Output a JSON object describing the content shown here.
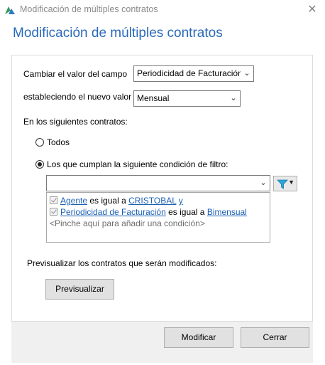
{
  "window": {
    "title": "Modificación de múltiples contratos",
    "close_glyph": "✕",
    "icon": "app-logo-icon"
  },
  "heading": "Modificación de múltiples contratos",
  "field_change": {
    "label": "Cambiar el valor del campo",
    "selected": "Periodicidad de Facturación"
  },
  "new_value": {
    "label": "estableciendo el nuevo valor",
    "selected": "Mensual"
  },
  "contracts_label": "En los siguientes contratos:",
  "options": {
    "all": {
      "label": "Todos",
      "selected": false
    },
    "filter": {
      "label": "Los que cumplan la siguiente condición de filtro:",
      "selected": true
    }
  },
  "filter_combo": {
    "value": ""
  },
  "filter_button_icon": "funnel-icon",
  "conditions": [
    {
      "field": "Agente",
      "op": " es igual a ",
      "value": "CRISTOBAL",
      "join": "y"
    },
    {
      "field": "Periodicidad de Facturación",
      "op": " es igual a ",
      "value": "Bimensual",
      "join": ""
    }
  ],
  "add_condition_hint": "<Pinche aquí para añadir una condición>",
  "preview": {
    "label": "Previsualizar los contratos que serán modificados:",
    "button": "Previsualizar"
  },
  "buttons": {
    "modify": "Modificar",
    "close": "Cerrar"
  },
  "colors": {
    "heading": "#2a69b8",
    "link": "#1a5fb4",
    "filter_icon": "#2aa7d8"
  }
}
